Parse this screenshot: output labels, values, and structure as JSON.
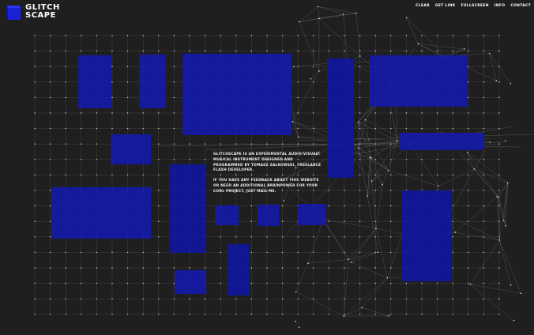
{
  "brand": {
    "line1": "GLITCH",
    "line2": "SCAPE",
    "accent": "#1a22d6"
  },
  "nav": [
    "CLEAR",
    "GET LINK",
    "FULLSCREEN",
    "INFO",
    "CONTACT"
  ],
  "info": {
    "para1": "GLITCHSCAPE IS AN EXPERIMENTAL AUDIO/VISUAL MUSICAL INSTRUMENT DESIGNED AND PROGRAMMED BY TOMASZ ZALKOWSKI, FREELANCE FLASH DEVELOPER.",
    "para2": "IF YOU HAVE ANY FEEDBACK ABOUT THIS WEBSITE OR NEED AN ADDITIONAL BRAINPOWER FOR YOUR COOL PROJECT, JUST MAIL ME.",
    "close": "×"
  },
  "colors": {
    "background": "#1f1f1f",
    "block": "#141aaa",
    "grid_line": "#4a4a4a",
    "grid_dot": "#d8d8d8"
  }
}
